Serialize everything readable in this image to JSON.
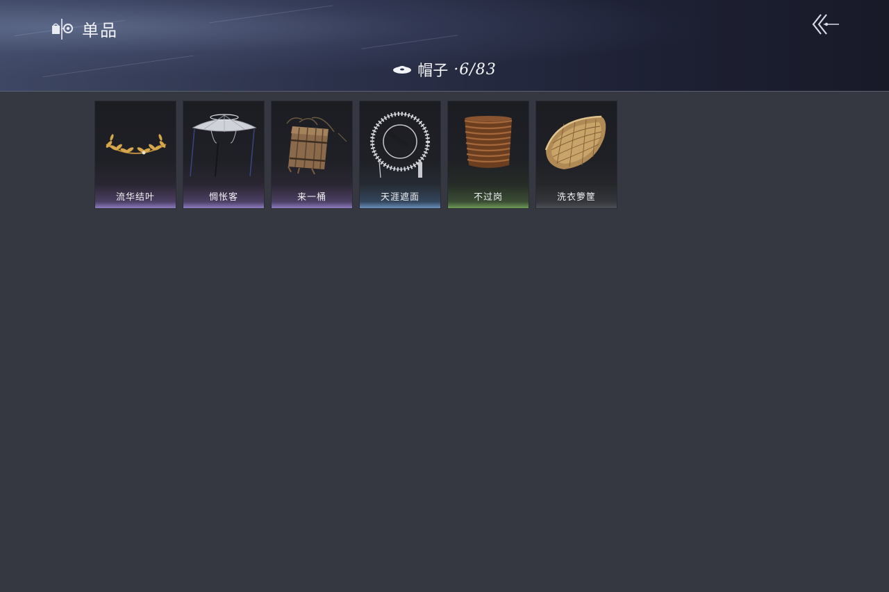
{
  "header": {
    "title": "单品",
    "back_icon": "back-chevrons-icon",
    "brand_icon": "wardrobe-icon"
  },
  "category": {
    "icon": "hat-icon",
    "name": "帽子",
    "count": "·6/83"
  },
  "items": [
    {
      "name": "流华结叶",
      "rarity": "purple",
      "icon": "laurel-wreath-icon"
    },
    {
      "name": "惆怅客",
      "rarity": "purple",
      "icon": "bamboo-hat-icon"
    },
    {
      "name": "来一桶",
      "rarity": "purple",
      "icon": "wooden-bucket-icon"
    },
    {
      "name": "天涯遮面",
      "rarity": "blue",
      "icon": "veiled-hat-icon"
    },
    {
      "name": "不过岗",
      "rarity": "green",
      "icon": "stacked-bowls-icon"
    },
    {
      "name": "洗衣箩筐",
      "rarity": "gray",
      "icon": "wicker-basket-icon"
    }
  ],
  "colors": {
    "background": "#353841",
    "rarity_purple": "#8e7bc0",
    "rarity_blue": "#6a8fbb",
    "rarity_green": "#6d9a56",
    "rarity_gray": "#4d5057"
  }
}
